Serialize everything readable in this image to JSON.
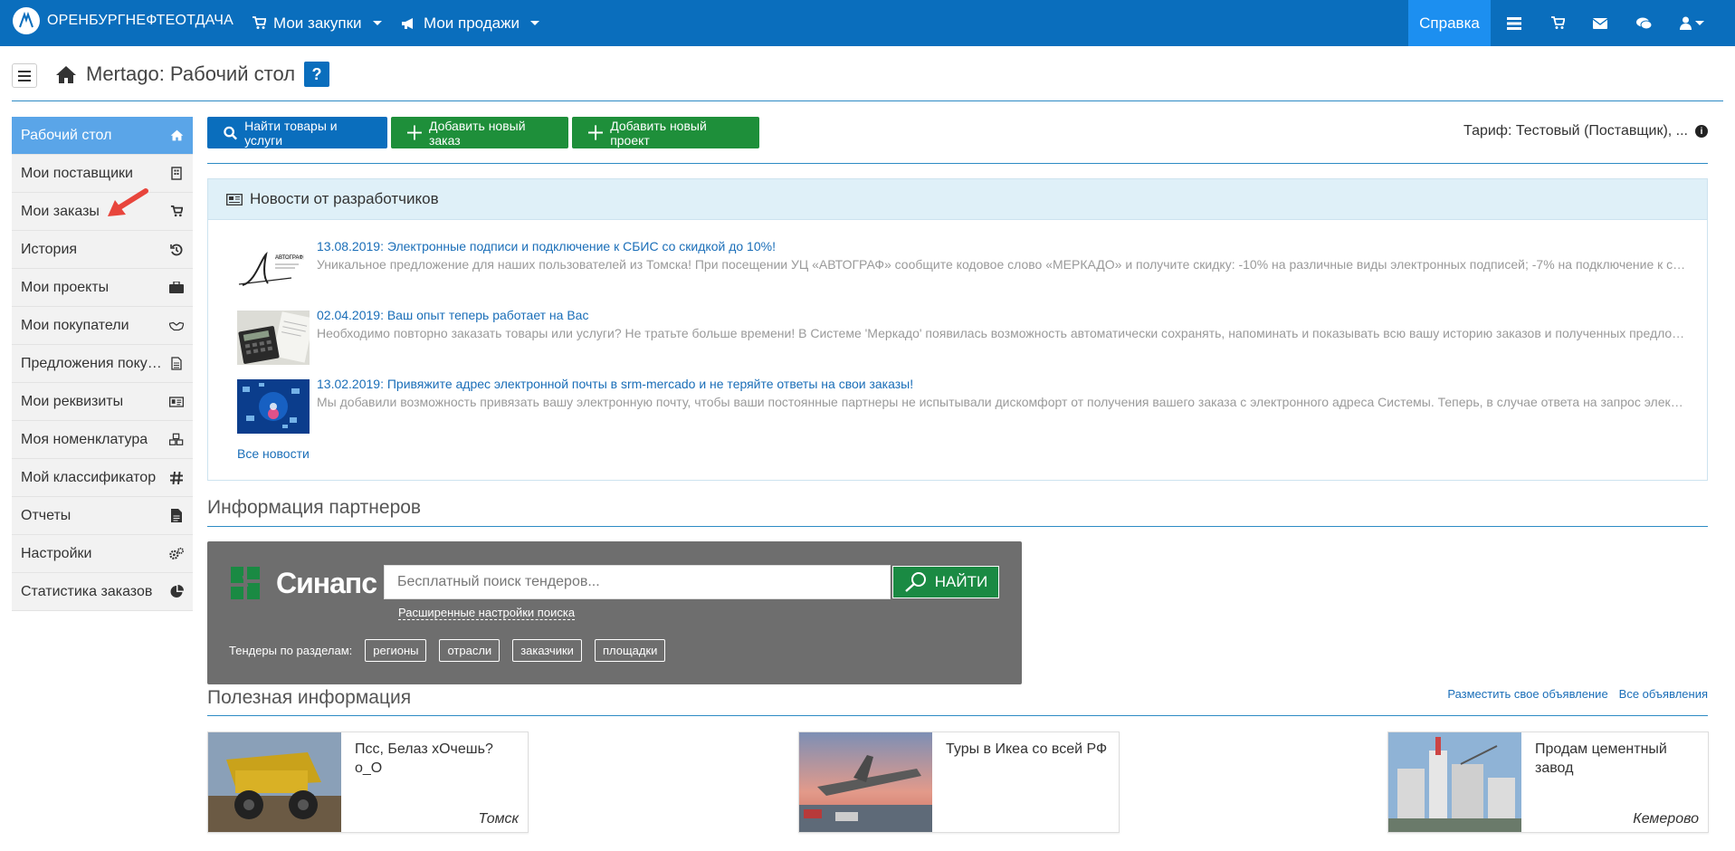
{
  "topbar": {
    "brand": "ОРЕНБУРГНЕФТЕОТДАЧА",
    "menu_purchases": "Мои закупки",
    "menu_sales": "Мои продажи",
    "help": "Справка"
  },
  "header": {
    "title": "Mertago: Рабочий стол",
    "help_badge": "?"
  },
  "sidebar": {
    "items": [
      {
        "label": "Рабочий стол",
        "icon": "home-icon"
      },
      {
        "label": "Мои поставщики",
        "icon": "building-icon"
      },
      {
        "label": "Мои заказы",
        "icon": "cart-icon"
      },
      {
        "label": "История",
        "icon": "history-icon"
      },
      {
        "label": "Мои проекты",
        "icon": "briefcase-icon"
      },
      {
        "label": "Мои покупатели",
        "icon": "handshake-icon"
      },
      {
        "label": "Предложения покупателей",
        "icon": "document-icon"
      },
      {
        "label": "Мои реквизиты",
        "icon": "id-card-icon"
      },
      {
        "label": "Моя номенклатура",
        "icon": "cubes-icon"
      },
      {
        "label": "Мой классификатор",
        "icon": "hashtag-icon"
      },
      {
        "label": "Отчеты",
        "icon": "file-icon"
      },
      {
        "label": "Настройки",
        "icon": "gears-icon"
      },
      {
        "label": "Статистика заказов",
        "icon": "pie-chart-icon"
      }
    ]
  },
  "actions": {
    "find": "Найти товары и услуги",
    "add_order": "Добавить новый заказ",
    "add_project": "Добавить новый проект",
    "tariff": "Тариф: Тестовый (Поставщик), ..."
  },
  "news": {
    "heading": "Новости от разработчиков",
    "items": [
      {
        "title": "13.08.2019: Электронные подписи и подключение к СБИС со скидкой до 10%!",
        "text": "Уникальное предложение для наших пользователей из Томска! При посещении УЦ «АВТОГРАФ» сообщите кодовое слово «МЕРКАДО» и получите скидку: -10% на различные виды электронных подписей; -7% на подключение к системе СБИС..."
      },
      {
        "title": "02.04.2019: Ваш опыт теперь работает на Вас",
        "text": "Необходимо повторно заказать товары или услуги? Не тратьте больше времени! В Системе 'Меркадо' появилась возможность автоматически сохранять, напоминать и показывать всю вашу историю заказов и полученных предложений..."
      },
      {
        "title": "13.02.2019: Привяжите адрес электронной почты в srm-mercado и не теряйте ответы на свои заказы!",
        "text": "Мы добавили возможность привязать вашу электронную почту, чтобы ваши постоянные партнеры не испытывали дискомфорт от получения вашего заказа с электронного адреса Системы. Теперь, в случае ответа на запрос электронной почтой..."
      }
    ],
    "all": "Все новости"
  },
  "partners": {
    "heading": "Информация партнеров",
    "logo_text": "Синапс",
    "search_placeholder": "Бесплатный поиск тендеров...",
    "search_button": "НАЙТИ",
    "advanced": "Расширенные настройки поиска",
    "sections_label": "Тендеры по разделам:",
    "tags": [
      "регионы",
      "отрасли",
      "заказчики",
      "площадки"
    ]
  },
  "useful": {
    "heading": "Полезная информация",
    "post_ad": "Разместить свое объявление",
    "all_ads": "Все объявления",
    "cards": [
      {
        "title": "Псс, Белаз хОчешь? о_О",
        "city": "Томск"
      },
      {
        "title": "Туры в Икеа со всей РФ",
        "city": ""
      },
      {
        "title": "Продам цементный завод",
        "city": "Кемерово"
      }
    ]
  },
  "colors": {
    "primary": "#0a6ebd",
    "green": "#1e8f3a",
    "sidebar_active": "#5aa5e8"
  }
}
